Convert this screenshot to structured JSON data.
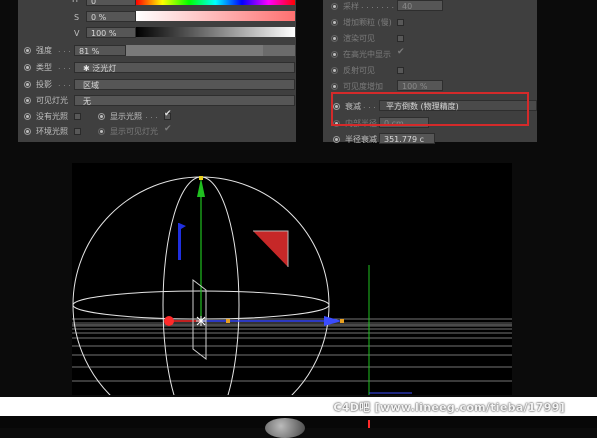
{
  "left": {
    "h_value": "0",
    "s_label": "S",
    "s_value": "0 %",
    "v_label": "V",
    "v_value": "100 %",
    "intensity_label": "强度",
    "intensity_value": "81 %",
    "type_label": "类型",
    "type_value": "泛光灯",
    "shadow_label": "投影",
    "shadow_value": "区域",
    "visible_light_label": "可见灯光",
    "visible_light_value": "无",
    "no_illum_label": "没有光照",
    "show_illum_label": "显示光照",
    "ambient_label": "环境光照",
    "show_visible_label": "显示可见灯光"
  },
  "right": {
    "samples_label": "采样",
    "samples_value": "40",
    "add_grain_label": "增加颗粒 (慢)",
    "render_visible_label": "渲染可见",
    "show_in_editor_label": "在高光中显示",
    "reflection_visible_label": "反射可见",
    "visibility_add_label": "可见度增加",
    "visibility_add_value": "100 %",
    "falloff_label": "衰减",
    "falloff_value": "平方倒数 (物理精度)",
    "inner_radius_label": "内部半径",
    "inner_radius_value": "0 cm",
    "radius_label": "半径衰减",
    "radius_value": "351.779 c"
  },
  "watermark": "C4D吧 [www.lineeg.com/tieba/1799]",
  "colors": {
    "accent_red": "#d42a2a",
    "axis_x": "#ff2a2a",
    "axis_y": "#20c020",
    "axis_z": "#3a4cff"
  }
}
